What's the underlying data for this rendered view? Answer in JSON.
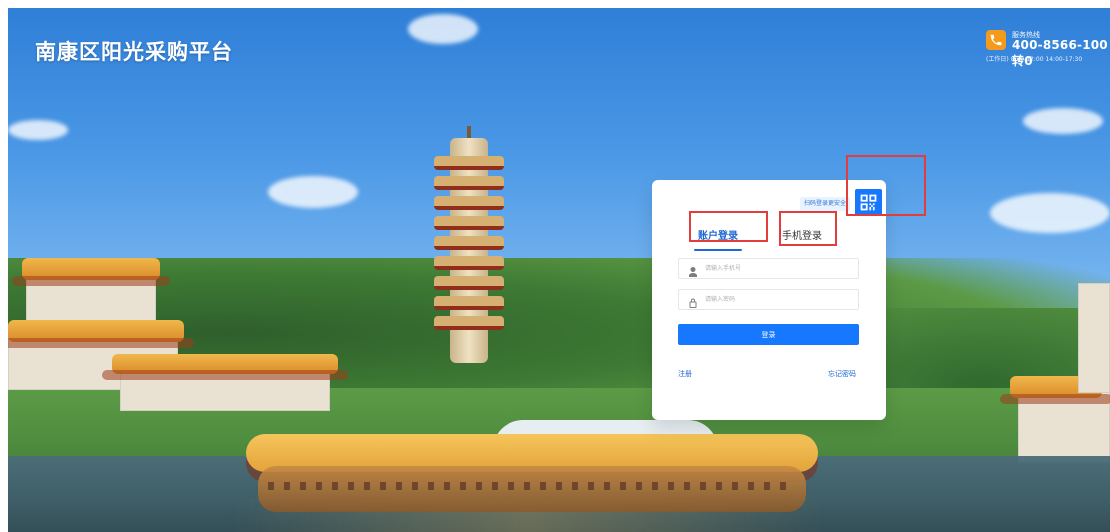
{
  "header": {
    "title": "南康区阳光采购平台"
  },
  "hotline": {
    "label": "服务热线",
    "number": "400-8566-100转0",
    "hours": "(工作日) 8:30-12:00 14:00-17:30",
    "icon": "phone-icon"
  },
  "login": {
    "qr_hint": "扫码登录更安全",
    "qr_icon": "qr-code-icon",
    "tabs": [
      {
        "label": "账户登录",
        "active": true
      },
      {
        "label": "手机登录",
        "active": false
      }
    ],
    "phone": {
      "placeholder": "请输入手机号",
      "value": ""
    },
    "password": {
      "placeholder": "请输入密码",
      "value": ""
    },
    "submit_label": "登录",
    "register_label": "注册",
    "forgot_label": "忘记密码"
  },
  "colors": {
    "primary": "#1677ff",
    "highlight_red": "#e23d3d",
    "phone_orange": "#f59b1b"
  }
}
